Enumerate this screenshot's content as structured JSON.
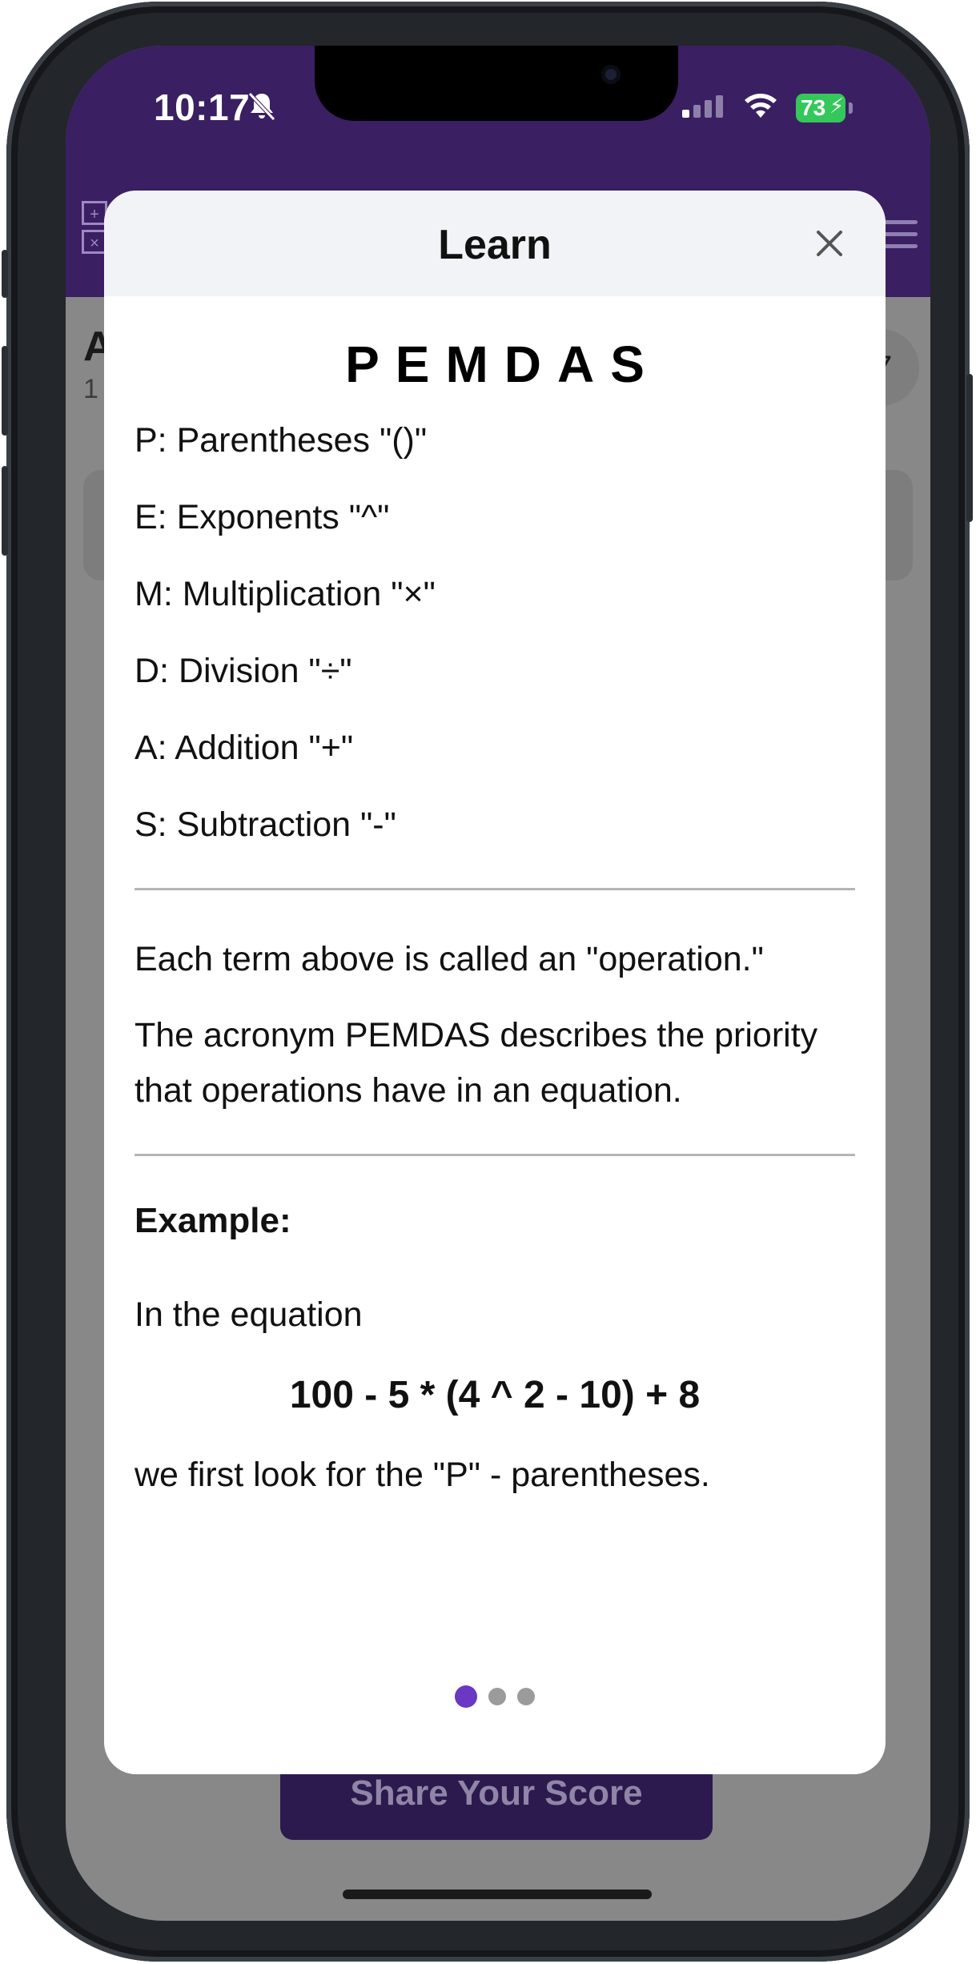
{
  "status_bar": {
    "time": "10:17",
    "battery_level": "73",
    "silent_icon": "bell-slash-icon",
    "signal_icon": "cellular-signal-icon",
    "wifi_icon": "wifi-icon",
    "charging_icon": "bolt-icon"
  },
  "background": {
    "share_label": "Share Your Score",
    "title_fragment": "A",
    "subtitle_fragment": "1",
    "badge_fragment": "7",
    "colors": {
      "app_bar": "#3a1f63",
      "overlay": "#888888"
    }
  },
  "modal": {
    "title": "Learn",
    "close_icon": "close-icon",
    "heading": "PEMDAS",
    "operations": [
      "P: Parentheses \"()\"",
      "E: Exponents \"^\"",
      "M: Multiplication \"×\"",
      "D: Division \"÷\"",
      "A: Addition \"+\"",
      "S: Subtraction \"-\""
    ],
    "paragraph1": "Each term above is called an \"operation.\"",
    "paragraph2": "The acronym PEMDAS describes the priority that operations have in an equation.",
    "example_label": "Example:",
    "example_intro": "In the equation",
    "equation": "100 - 5 * (4 ^ 2 - 10) + 8",
    "example_followup": "we first look for the \"P\" - parentheses.",
    "pagination": {
      "current_page": 1,
      "total_pages": 3,
      "active_color": "#6a38c2"
    }
  }
}
